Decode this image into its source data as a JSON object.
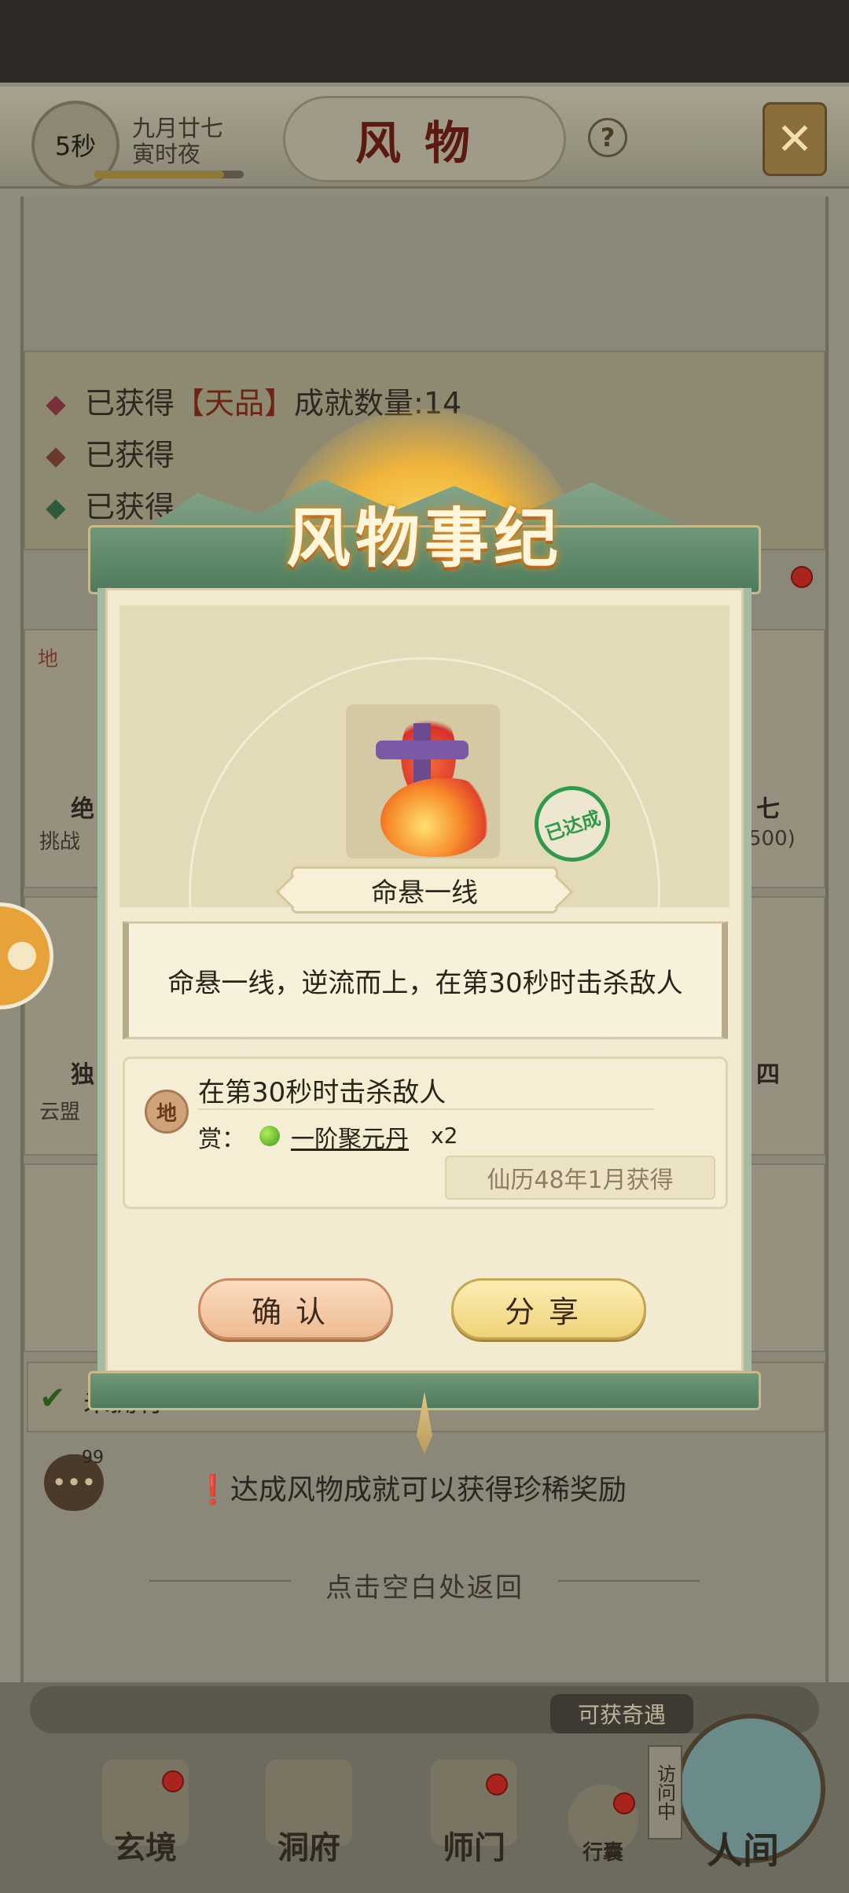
{
  "header": {
    "timer": "5秒",
    "date_line1": "九月廿七",
    "date_line2": "寅时夜",
    "title": "风物",
    "help_symbol": "?",
    "time_progress": 0.87
  },
  "stats": {
    "row1_prefix": "已获得",
    "row1_grade": "【天品】",
    "row1_suffix": "成就数量:14",
    "row2_prefix": "已获得",
    "row3_prefix": "已获得",
    "diamond_colors": [
      "#7a2f3a",
      "#6a3a2a",
      "#2f5a3a"
    ]
  },
  "side_cards": {
    "left_top_title": "绝",
    "left_top_sub": "挑战",
    "right_top_title": "七",
    "right_top_sub": "500)",
    "left_mid_title": "独",
    "left_mid_sub": "云盟",
    "right_mid_title": "四",
    "corner_tag": "地"
  },
  "filter": {
    "label": "未拥有"
  },
  "messages": {
    "badge": "99",
    "hint": "达成风物成就可以获得珍稀奖励"
  },
  "back_hint": "点击空白处返回",
  "modal": {
    "title": "风物事纪",
    "achievement_name": "命悬一线",
    "description": "命悬一线，逆流而上，在第30秒时击杀敌人",
    "stamp_text": "已达成",
    "task": {
      "badge": "地",
      "condition": "在第30秒时击杀敌人",
      "reward_label": "赏：",
      "reward_item": "一阶聚元丹",
      "reward_qty": "x2",
      "obtained_date": "仙历48年1月获得"
    },
    "confirm_label": "确认",
    "share_label": "分享"
  },
  "bottom_nav": {
    "chance_tag": "可获奇遇",
    "visit_tag": "访问中",
    "items": [
      {
        "label": "玄境"
      },
      {
        "label": "洞府"
      },
      {
        "label": "师门"
      },
      {
        "label": "行囊"
      },
      {
        "label": "人间"
      }
    ]
  },
  "colors": {
    "modal_bar": "#4f7a5c",
    "stamp_green": "#2f9a4a",
    "confirm_button": "#eebb92",
    "share_button": "#f0d27a"
  }
}
